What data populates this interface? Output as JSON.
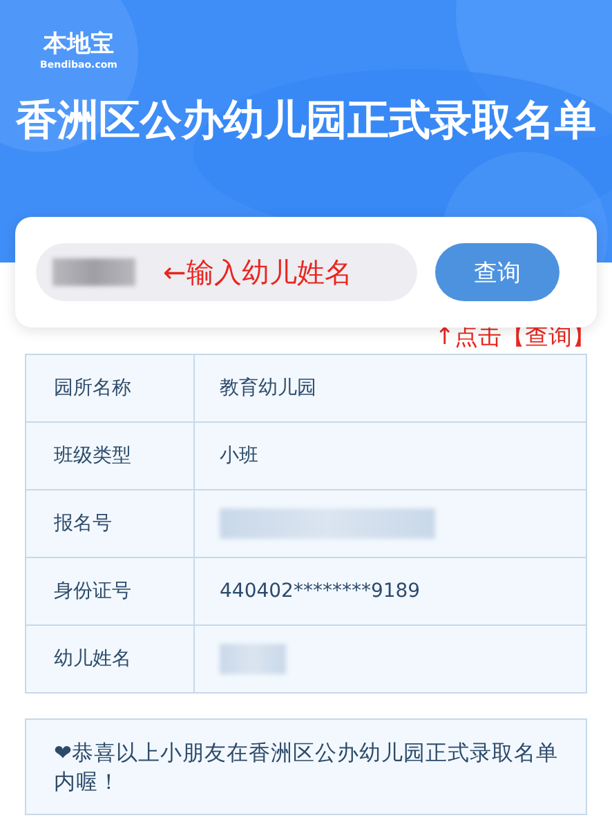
{
  "header": {
    "logo": {
      "name": "本地宝",
      "domain": "Bendibao.com"
    },
    "title": "香洲区公办幼儿园正式录取名单"
  },
  "search": {
    "value_blurred": true,
    "hint": "←输入幼儿姓名",
    "button": "查询",
    "button_hint": "↑点击【查询】"
  },
  "table": {
    "rows": [
      {
        "label": "园所名称",
        "kind": "text",
        "value": "教育幼儿园"
      },
      {
        "label": "班级类型",
        "kind": "text",
        "value": "小班"
      },
      {
        "label": "报名号",
        "kind": "blurred",
        "wide": true
      },
      {
        "label": "身份证号",
        "kind": "text",
        "value": "440402********9189"
      },
      {
        "label": "幼儿姓名",
        "kind": "blurred",
        "wide": false
      }
    ]
  },
  "notice": "❤恭喜以上小朋友在香洲区公办幼儿园正式录取名单内喔！"
}
